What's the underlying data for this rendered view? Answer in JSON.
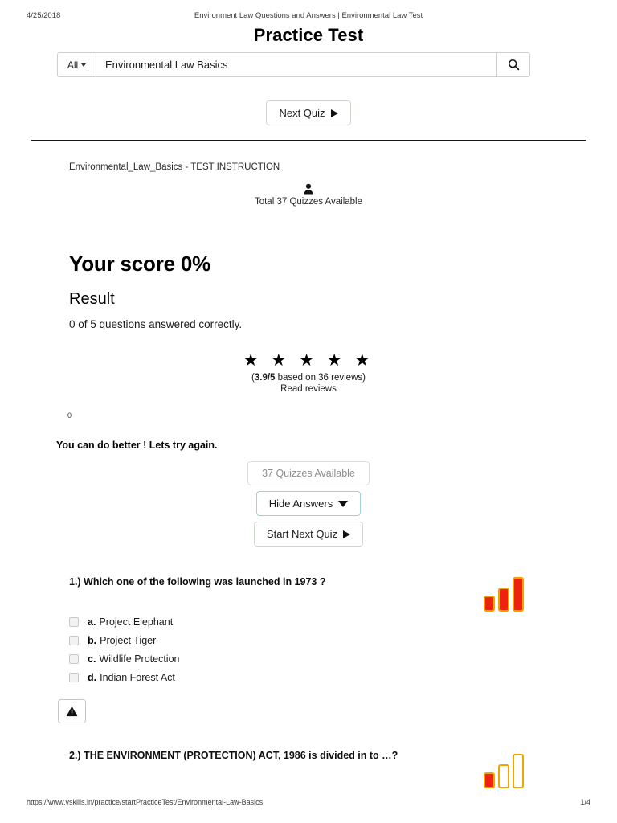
{
  "print_header": {
    "date": "4/25/2018",
    "document_title": "Environment Law Questions and Answers | Environmental Law Test"
  },
  "page_title": "Practice Test",
  "search": {
    "scope_label": "All",
    "query_value": "Environmental Law Basics",
    "placeholder": "Environmental Law Basics",
    "search_icon": "search-icon",
    "caret_icon": "chevron-down-icon"
  },
  "top_actions": {
    "next_quiz_label": "Next Quiz",
    "play_icon": "play-triangle-icon"
  },
  "instruction": "Environmental_Law_Basics - TEST INSTRUCTION",
  "quiz_meta": {
    "person_icon": "person-icon",
    "total_label": "Total 37 Quizzes Available"
  },
  "score": {
    "heading": "Your score 0%",
    "result_heading": "Result",
    "result_detail": "0 of 5 questions answered correctly."
  },
  "rating": {
    "stars": "★ ★ ★ ★ ★",
    "star_count": 5,
    "score_text": "3.9/5",
    "suffix_text": " based on 36 reviews)",
    "prefix_text": "(",
    "read_reviews_label": "Read reviews"
  },
  "zero_marker": "0",
  "encouragement": "You can do better ! Lets try again.",
  "actions": {
    "quizzes_available_label": "37 Quizzes Available",
    "hide_answers_label": "Hide Answers",
    "start_next_quiz_label": "Start Next Quiz",
    "caret_down_icon": "chevron-down-icon",
    "play_icon": "play-triangle-icon"
  },
  "questions": [
    {
      "text": "1.) Which one of the following was launched in 1973 ?",
      "options": [
        {
          "letter": "a.",
          "label": "Project Elephant"
        },
        {
          "letter": "b.",
          "label": "Project Tiger"
        },
        {
          "letter": "c.",
          "label": "Wildlife Protection"
        },
        {
          "letter": "d.",
          "label": "Indian Forest Act"
        }
      ]
    },
    {
      "text": "2.) THE ENVIRONMENT (PROTECTION) ACT, 1986 is divided in to …?",
      "options": []
    }
  ],
  "warn_button": {
    "icon": "warning-triangle-icon"
  },
  "chart_data": [
    {
      "type": "bar",
      "name": "question-1-difficulty-bars",
      "categories": [
        "1",
        "2",
        "3"
      ],
      "values": [
        1,
        2,
        3
      ],
      "filled": [
        true,
        true,
        true
      ],
      "title": "",
      "fill_color": "#ee2211",
      "stroke_color": "#f0a500",
      "ylim": [
        0,
        3
      ],
      "grid": false
    },
    {
      "type": "bar",
      "name": "question-2-difficulty-bars",
      "categories": [
        "1",
        "2",
        "3"
      ],
      "values": [
        1,
        2,
        3
      ],
      "filled": [
        true,
        false,
        false
      ],
      "title": "",
      "fill_color": "#ee2211",
      "stroke_color": "#f0a500",
      "ylim": [
        0,
        3
      ],
      "grid": false
    }
  ],
  "footer": {
    "url": "https://www.vskills.in/practice/startPracticeTest/Environmental-Law-Basics",
    "page_number": "1/4"
  },
  "colors": {
    "teal_border": "#9fd4d4",
    "green_border": "#cdd8cd",
    "bar_red": "#ee2211",
    "bar_gold": "#f0a500"
  }
}
